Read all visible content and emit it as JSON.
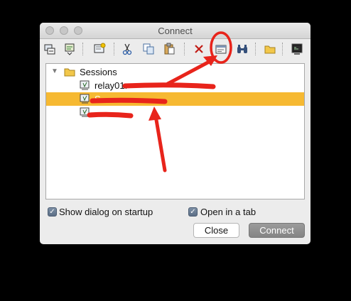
{
  "window": {
    "title": "Connect"
  },
  "toolbar": {
    "buttons": [
      {
        "icon": "quick-connect-icon"
      },
      {
        "icon": "connect-session-icon"
      },
      {
        "icon": "new-session-icon"
      },
      {
        "icon": "cut-icon"
      },
      {
        "icon": "copy-icon"
      },
      {
        "icon": "paste-icon"
      },
      {
        "icon": "delete-icon"
      },
      {
        "icon": "properties-icon"
      },
      {
        "icon": "find-icon"
      },
      {
        "icon": "new-folder-icon"
      },
      {
        "icon": "connect-terminal-icon"
      }
    ]
  },
  "tree": {
    "root": {
      "label": "Sessions",
      "expanded": true
    },
    "items": [
      {
        "label": "relay01.",
        "redacted": true
      },
      {
        "label": "S",
        "redacted": true,
        "selected": true
      },
      {
        "label": "",
        "redacted": true
      }
    ]
  },
  "options": {
    "show_dialog_on_startup": {
      "label": "Show dialog on startup",
      "checked": true
    },
    "open_in_tab": {
      "label": "Open in a tab",
      "checked": true
    }
  },
  "buttons": {
    "close": "Close",
    "connect": "Connect"
  },
  "colors": {
    "selection": "#f6b932",
    "annotation": "#e8241b"
  }
}
